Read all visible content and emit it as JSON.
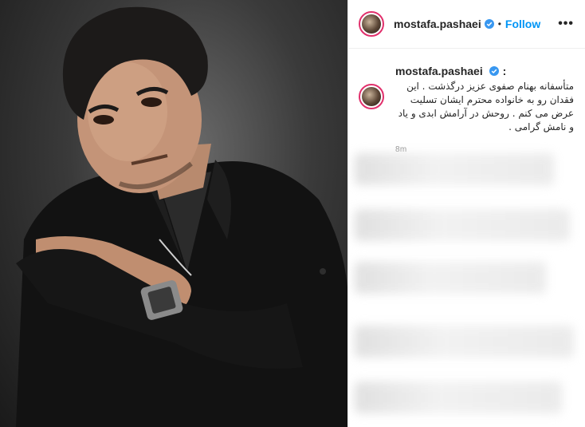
{
  "post": {
    "username": "mostafa.pashaei",
    "follow_label": "Follow",
    "separator": "•",
    "more_glyph": "•••",
    "caption_user": "mostafa.pashaei",
    "caption_colon": ":",
    "caption_text": "متأسفانه بهنام صفوی عزیز درگذشت . این فقدان رو به خانواده محترم ایشان تسلیت عرض می کنم . روحش در آرامش ابدی و یاد و نامش گرامی .",
    "time": "8m"
  },
  "colors": {
    "accent": "#0095f6",
    "story_ring": "#e1306c",
    "verified": "#3897f0"
  },
  "icons": {
    "verified": "verified-badge-icon",
    "more": "more-options-icon"
  }
}
